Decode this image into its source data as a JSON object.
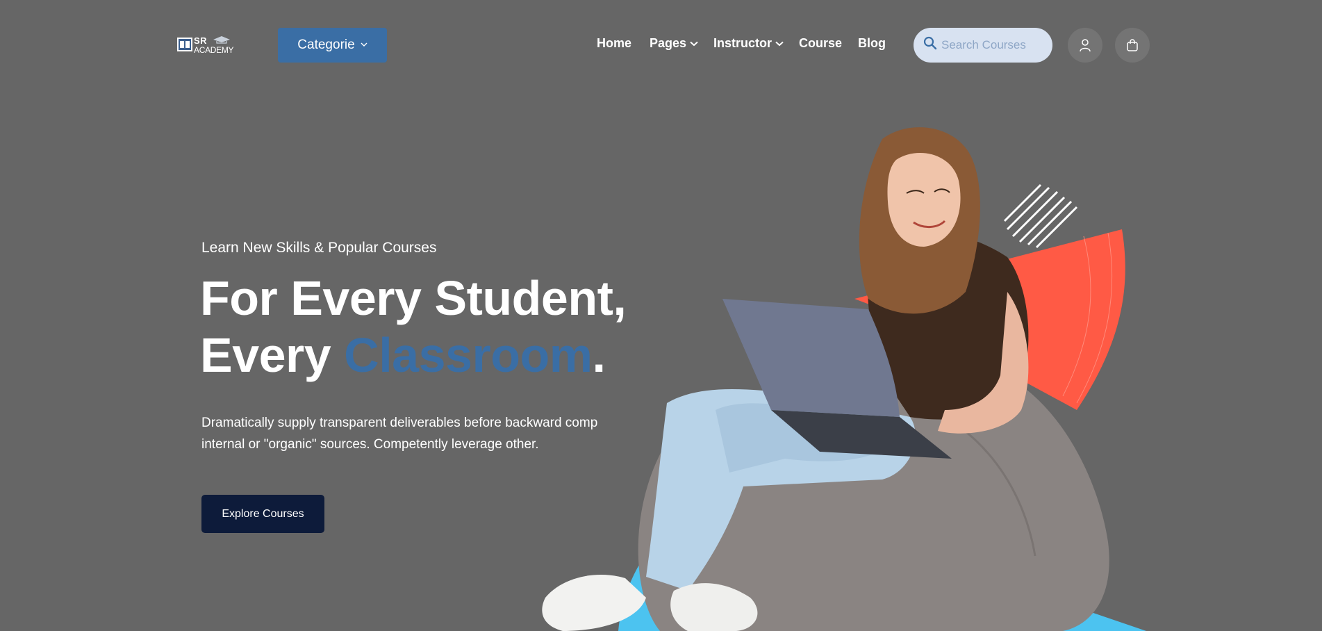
{
  "logo": {
    "line1": "SR",
    "line2": "ACADEMY"
  },
  "header": {
    "category_button": "Categorie",
    "nav": [
      {
        "label": "Home",
        "has_dropdown": false
      },
      {
        "label": "Pages",
        "has_dropdown": true
      },
      {
        "label": "Instructor",
        "has_dropdown": true
      },
      {
        "label": "Course",
        "has_dropdown": false
      },
      {
        "label": "Blog",
        "has_dropdown": false
      }
    ],
    "search": {
      "placeholder": "Search Courses",
      "icon": "search-icon"
    },
    "icons": [
      "user-icon",
      "shopping-bag-icon"
    ]
  },
  "hero": {
    "kicker": "Learn New Skills & Popular Courses",
    "headline_line1": "For Every Student,",
    "headline_line2_prefix": "Every ",
    "headline_accent": "Classroom",
    "headline_suffix": ".",
    "description": "Dramatically supply transparent deliverables before backward comp internal or \"organic\" sources. Competently leverage other.",
    "cta": "Explore Courses"
  },
  "colors": {
    "background": "#666666",
    "accent_blue": "#3a6ea5",
    "cta_navy": "#0d1b3a",
    "search_bg": "#d8e2f1",
    "deco_red": "#ff5a45",
    "deco_cyan": "#4cc3f0"
  }
}
